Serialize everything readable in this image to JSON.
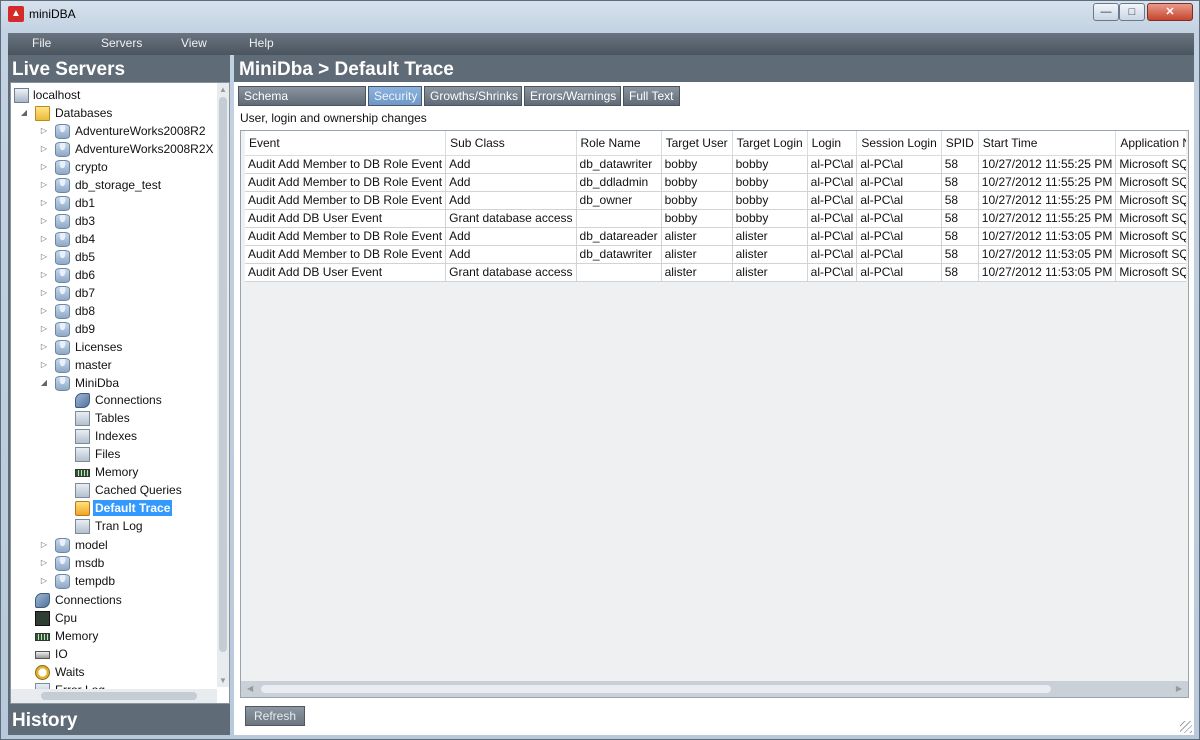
{
  "window": {
    "title": "miniDBA",
    "app_icon": "minidba-logo-icon",
    "brand_color": "#d42a2a"
  },
  "menu": [
    "File",
    "Servers",
    "View",
    "Help"
  ],
  "left_panel": {
    "title": "Live Servers",
    "bottom_title": "History",
    "tree": [
      {
        "label": "localhost",
        "icon": "server-icon"
      },
      {
        "label": "Databases",
        "icon": "folder-icon"
      },
      {
        "label": "AdventureWorks2008R2",
        "icon": "database-icon"
      },
      {
        "label": "AdventureWorks2008R2X",
        "icon": "database-icon"
      },
      {
        "label": "crypto",
        "icon": "database-icon"
      },
      {
        "label": "db_storage_test",
        "icon": "database-icon"
      },
      {
        "label": "db1",
        "icon": "database-icon"
      },
      {
        "label": "db3",
        "icon": "database-icon"
      },
      {
        "label": "db4",
        "icon": "database-icon"
      },
      {
        "label": "db5",
        "icon": "database-icon"
      },
      {
        "label": "db6",
        "icon": "database-icon"
      },
      {
        "label": "db7",
        "icon": "database-icon"
      },
      {
        "label": "db8",
        "icon": "database-icon"
      },
      {
        "label": "db9",
        "icon": "database-icon"
      },
      {
        "label": "Licenses",
        "icon": "database-icon"
      },
      {
        "label": "master",
        "icon": "database-icon"
      },
      {
        "label": "MiniDba",
        "icon": "database-icon"
      },
      {
        "label": "Connections",
        "icon": "connections-icon"
      },
      {
        "label": "Tables",
        "icon": "tables-icon"
      },
      {
        "label": "Indexes",
        "icon": "indexes-icon"
      },
      {
        "label": "Files",
        "icon": "files-icon"
      },
      {
        "label": "Memory",
        "icon": "memory-icon"
      },
      {
        "label": "Cached Queries",
        "icon": "cached-queries-icon"
      },
      {
        "label": "Default Trace",
        "icon": "trace-icon"
      },
      {
        "label": "Tran Log",
        "icon": "tran-log-icon"
      },
      {
        "label": "model",
        "icon": "database-icon"
      },
      {
        "label": "msdb",
        "icon": "database-icon"
      },
      {
        "label": "tempdb",
        "icon": "database-icon"
      },
      {
        "label": "Connections",
        "icon": "connections-icon"
      },
      {
        "label": "Cpu",
        "icon": "cpu-icon"
      },
      {
        "label": "Memory",
        "icon": "memory-icon"
      },
      {
        "label": "IO",
        "icon": "io-icon"
      },
      {
        "label": "Waits",
        "icon": "waits-icon"
      },
      {
        "label": "Error Log",
        "icon": "error-log-icon"
      }
    ]
  },
  "right_panel": {
    "breadcrumb": "MiniDba > Default Trace",
    "tabs": [
      "Schema Modifications",
      "Security",
      "Growths/Shrinks",
      "Errors/Warnings",
      "Full Text"
    ],
    "active_tab": "Security",
    "subtitle": "User, login and ownership changes",
    "columns": [
      "Event",
      "Sub Class",
      "Role Name",
      "Target User",
      "Target Login",
      "Login",
      "Session Login",
      "SPID",
      "Start Time",
      "Application Name"
    ],
    "rows": [
      [
        "Audit Add Member to DB Role Event",
        "Add",
        "db_datawriter",
        "bobby",
        "bobby",
        "al-PC\\al",
        "al-PC\\al",
        "58",
        "10/27/2012 11:55:25 PM",
        "Microsoft SQL Server Management Studio"
      ],
      [
        "Audit Add Member to DB Role Event",
        "Add",
        "db_ddladmin",
        "bobby",
        "bobby",
        "al-PC\\al",
        "al-PC\\al",
        "58",
        "10/27/2012 11:55:25 PM",
        "Microsoft SQL Server Management Studio"
      ],
      [
        "Audit Add Member to DB Role Event",
        "Add",
        "db_owner",
        "bobby",
        "bobby",
        "al-PC\\al",
        "al-PC\\al",
        "58",
        "10/27/2012 11:55:25 PM",
        "Microsoft SQL Server Management Studio"
      ],
      [
        "Audit Add DB User Event",
        "Grant database access",
        "",
        "bobby",
        "bobby",
        "al-PC\\al",
        "al-PC\\al",
        "58",
        "10/27/2012 11:55:25 PM",
        "Microsoft SQL Server Management Studio"
      ],
      [
        "Audit Add Member to DB Role Event",
        "Add",
        "db_datareader",
        "alister",
        "alister",
        "al-PC\\al",
        "al-PC\\al",
        "58",
        "10/27/2012 11:53:05 PM",
        "Microsoft SQL Server Management Studio"
      ],
      [
        "Audit Add Member to DB Role Event",
        "Add",
        "db_datawriter",
        "alister",
        "alister",
        "al-PC\\al",
        "al-PC\\al",
        "58",
        "10/27/2012 11:53:05 PM",
        "Microsoft SQL Server Management Studio"
      ],
      [
        "Audit Add DB User Event",
        "Grant database access",
        "",
        "alister",
        "alister",
        "al-PC\\al",
        "al-PC\\al",
        "58",
        "10/27/2012 11:53:05 PM",
        "Microsoft SQL Server Management Studio"
      ]
    ],
    "refresh_label": "Refresh"
  }
}
